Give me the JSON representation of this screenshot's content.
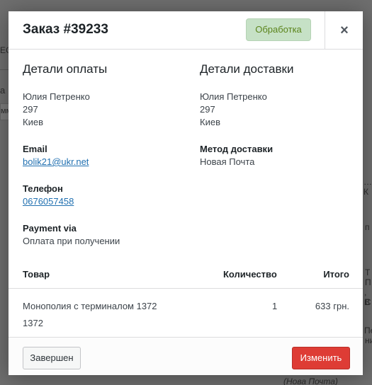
{
  "background": {
    "fragments": [
      "EC",
      "а",
      "мм",
      "…, К",
      "п",
      "Т",
      "П",
      ", В",
      "С",
      "ЕП",
      "Пе",
      "ни",
      "(Нова Почта)"
    ]
  },
  "modal": {
    "title": "Заказ #39233",
    "status": "Обработка",
    "close_glyph": "×"
  },
  "billing": {
    "heading": "Детали оплаты",
    "address_lines": [
      "Юлия Петренко",
      "297",
      "Киев"
    ],
    "email_label": "Email",
    "email": "bolik21@ukr.net",
    "phone_label": "Телефон",
    "phone": "0676057458",
    "payment_label": "Payment via",
    "payment": "Оплата при получении"
  },
  "shipping": {
    "heading": "Детали доставки",
    "address_lines": [
      "Юлия Петренко",
      "297",
      "Киев"
    ],
    "method_label": "Метод доставки",
    "method": "Новая Почта"
  },
  "items": {
    "columns": [
      "Товар",
      "Количество",
      "Итого"
    ],
    "rows": [
      {
        "name": "Монополия с терминалом 1372",
        "sku": "1372",
        "qty": "1",
        "total": "633 грн."
      }
    ]
  },
  "footer": {
    "complete_label": "Завершен",
    "edit_label": "Изменить"
  },
  "colors": {
    "status_bg": "#c6e1c6",
    "status_text": "#5b841b",
    "edit_button": "#de3c35",
    "link": "#2271b1"
  }
}
